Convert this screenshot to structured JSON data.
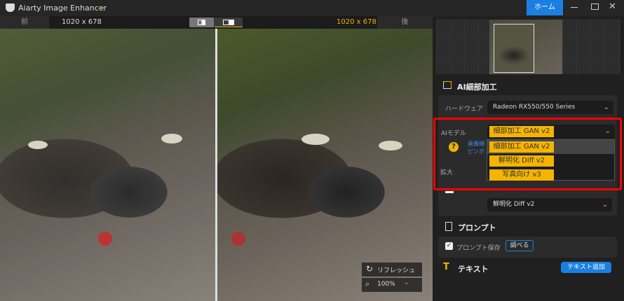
{
  "app": {
    "title": "Aiarty Image Enhancer",
    "home_label": "ホーム"
  },
  "toolbar": {
    "before_label": "前",
    "before_size": "1020 x 678",
    "after_size": "1020 x 678",
    "after_label": "後"
  },
  "viewer": {
    "refresh_label": "リフレッシュ",
    "zoom": "100%"
  },
  "panel": {
    "section_title": "AI細部加工",
    "hardware_label": "ハードウェア",
    "hardware_value": "Radeon RX550/550 Series",
    "model_label": "AIモデル",
    "model_value": "細部加工 GAN v2",
    "model_options": [
      "細部加工 GAN v2",
      "鮮明化 Diff v2",
      "写真向け v3"
    ],
    "help_text_1": "画像細",
    "help_text_2": "ピンボ",
    "upscale_label": "拡大",
    "second_select_value": "鮮明化 Diff v2",
    "prompt_title": "プロンプト",
    "prompt_save_label": "プロンプト保存",
    "prompt_check_label": "調べる",
    "text_title": "テキスト",
    "add_text_label": "テキスト追加"
  },
  "colors": {
    "accent": "#f5b400",
    "primary": "#1a7fe0",
    "highlight": "#ff0000"
  }
}
